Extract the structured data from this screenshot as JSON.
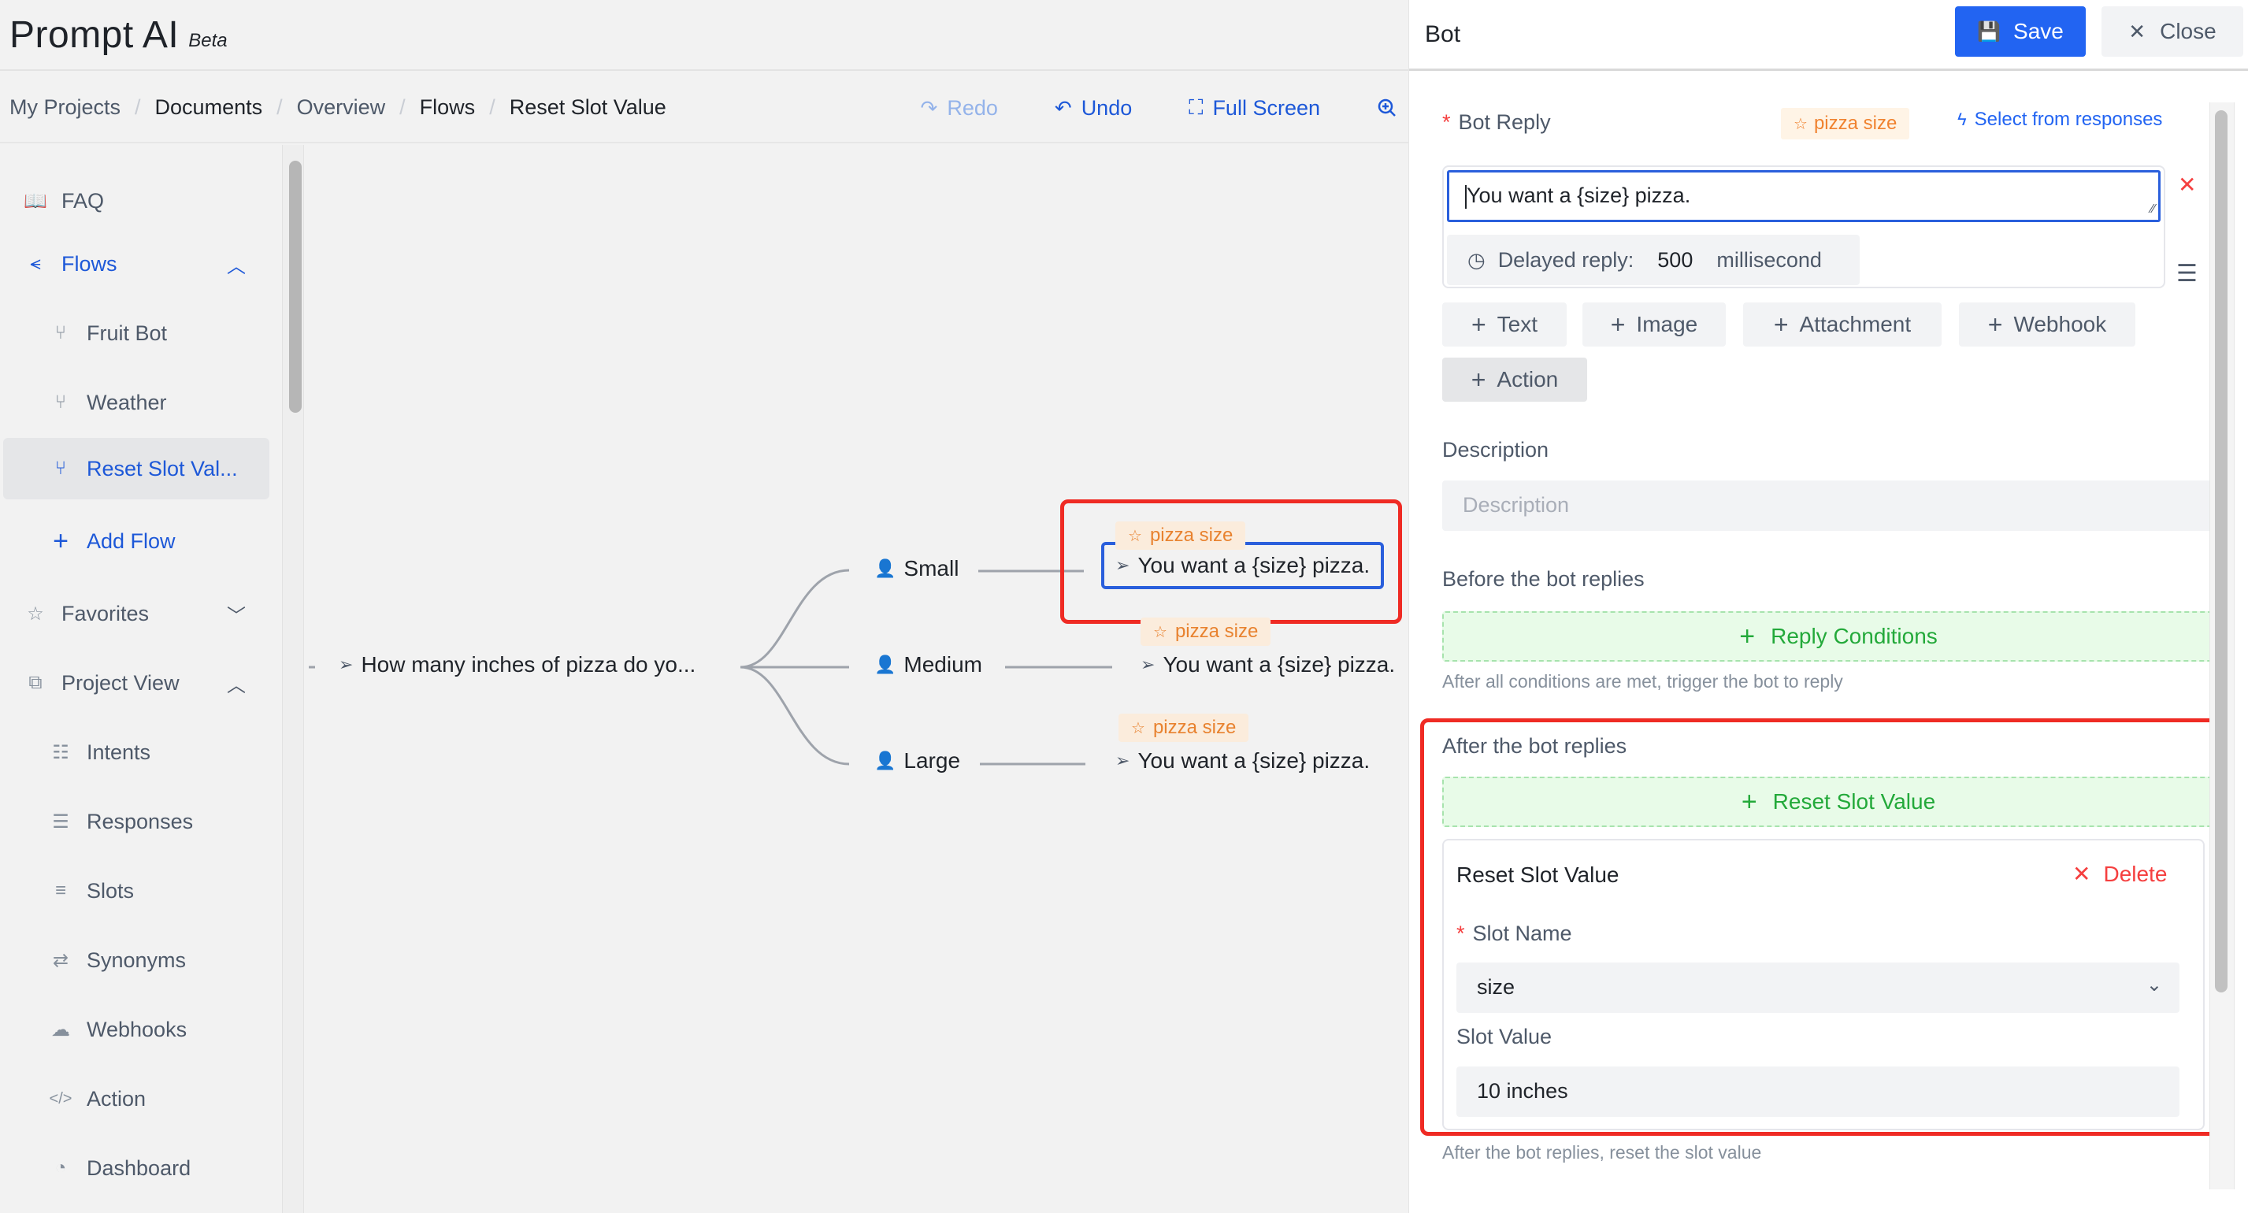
{
  "brand": {
    "name": "Prompt AI",
    "badge": "Beta"
  },
  "breadcrumb": [
    {
      "label": "My Projects",
      "style": "muted"
    },
    {
      "label": "Documents",
      "style": "dark"
    },
    {
      "label": "Overview",
      "style": "muted"
    },
    {
      "label": "Flows",
      "style": "dark"
    },
    {
      "label": "Reset Slot Value",
      "style": "dark"
    }
  ],
  "toolbar": {
    "redo": {
      "label": "Redo",
      "icon": "redo-icon",
      "disabled": true
    },
    "undo": {
      "label": "Undo",
      "icon": "undo-icon"
    },
    "fullscreen": {
      "label": "Full Screen",
      "icon": "fullscreen-icon"
    },
    "zoom": {
      "icon": "zoom-in-icon"
    }
  },
  "sidebar": {
    "items": [
      {
        "label": "FAQ",
        "icon": "book-icon",
        "level": 1
      },
      {
        "label": "Flows",
        "icon": "flows-icon",
        "level": 1,
        "expanded": true,
        "active_section": true
      },
      {
        "label": "Fruit Bot",
        "icon": "branch-icon",
        "level": 2
      },
      {
        "label": "Weather",
        "icon": "branch-icon",
        "level": 2
      },
      {
        "label": "Reset Slot Val...",
        "icon": "branch-icon",
        "level": 2,
        "selected": true
      },
      {
        "label": "Add Flow",
        "icon": "plus-icon",
        "level": 2,
        "action": true
      },
      {
        "label": "Favorites",
        "icon": "star-icon",
        "level": 1,
        "expanded": false
      },
      {
        "label": "Project View",
        "icon": "puzzle-icon",
        "level": 1,
        "expanded": true
      },
      {
        "label": "Intents",
        "icon": "intents-icon",
        "level": 2
      },
      {
        "label": "Responses",
        "icon": "responses-icon",
        "level": 2
      },
      {
        "label": "Slots",
        "icon": "slots-icon",
        "level": 2
      },
      {
        "label": "Synonyms",
        "icon": "synonyms-icon",
        "level": 2
      },
      {
        "label": "Webhooks",
        "icon": "cloud-icon",
        "level": 2
      },
      {
        "label": "Action",
        "icon": "code-icon",
        "level": 2
      },
      {
        "label": "Dashboard",
        "icon": "dashboard-icon",
        "level": 2
      }
    ]
  },
  "flow": {
    "root": {
      "label": "How many inches of pizza do yo...",
      "type": "bot"
    },
    "branches": [
      {
        "user": "Small",
        "reply": "You want a {size} pizza.",
        "tag": "pizza size",
        "selected": true
      },
      {
        "user": "Medium",
        "reply": "You want a {size} pizza.",
        "tag": "pizza size"
      },
      {
        "user": "Large",
        "reply": "You want a {size} pizza.",
        "tag": "pizza size"
      }
    ]
  },
  "panel": {
    "title": "Bot",
    "save_label": "Save",
    "close_label": "Close",
    "bot_reply": {
      "label": "Bot Reply",
      "required_mark": "*",
      "tag": "pizza size",
      "select_from_responses": "Select from responses",
      "text": "You want a {size} pizza.",
      "delay_label": "Delayed reply:",
      "delay_value": "500",
      "delay_unit": "millisecond"
    },
    "add_buttons": [
      {
        "label": "Text"
      },
      {
        "label": "Image"
      },
      {
        "label": "Attachment"
      },
      {
        "label": "Webhook"
      },
      {
        "label": "Action"
      }
    ],
    "description": {
      "label": "Description",
      "placeholder": "Description",
      "value": ""
    },
    "before": {
      "label": "Before the bot replies",
      "button": "Reply Conditions",
      "help": "After all conditions are met, trigger the bot to reply"
    },
    "after": {
      "label": "After the bot replies",
      "button": "Reset Slot Value",
      "help": "After the bot replies, reset the slot value",
      "card": {
        "title": "Reset Slot Value",
        "delete_label": "Delete",
        "slot_name_label": "Slot Name",
        "slot_name_value": "size",
        "slot_value_label": "Slot Value",
        "slot_value_value": "10 inches"
      }
    }
  },
  "colors": {
    "primary": "#2264f2",
    "danger": "#f53f3f",
    "success": "#23a93a",
    "tag_text": "#e8822f",
    "tag_bg": "#fbecdc",
    "annotation": "#ef2b24"
  }
}
